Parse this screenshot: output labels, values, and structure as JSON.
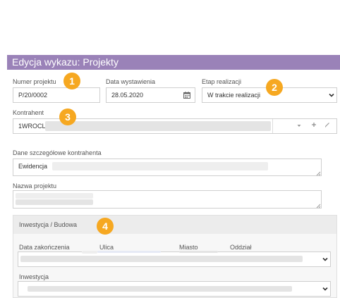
{
  "window": {
    "title": "Edycja wykazu: Projekty"
  },
  "form": {
    "project_number": {
      "label": "Numer projektu",
      "value": "P/20/0002"
    },
    "issue_date": {
      "label": "Data wystawienia",
      "value": "28.05.2020"
    },
    "stage": {
      "label": "Etap realizacji",
      "value": "W trakcie realizacji"
    },
    "contractor": {
      "label": "Kontrahent",
      "value": "1WROCLAW"
    },
    "contractor_details": {
      "label": "Dane szczegółowe kontrahenta",
      "value": "Ewidencja"
    },
    "project_name": {
      "label": "Nazwa projektu"
    }
  },
  "section": {
    "title": "Inwestycja / Budowa",
    "columns": [
      "Data zakończenia",
      "Ulica",
      "Miasto",
      "Oddział"
    ],
    "investment_label": "Inwestycja"
  },
  "badges": [
    "1",
    "2",
    "3",
    "4"
  ],
  "colors": {
    "titlebar": "#9a82b8",
    "badge": "#f6a821"
  },
  "icons": [
    "calendar-icon",
    "chevron-down-icon",
    "plus-icon",
    "edit-icon"
  ]
}
